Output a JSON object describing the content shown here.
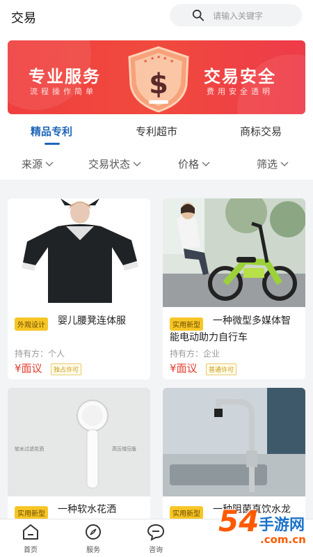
{
  "header": {
    "title": "交易",
    "search_placeholder": "请输入关键字"
  },
  "banner": {
    "left_title": "专业服务",
    "left_subtitle": "流程操作简单",
    "right_title": "交易安全",
    "right_subtitle": "费用安全透明",
    "shield_symbol": "$"
  },
  "tabs": [
    {
      "label": "精品专利",
      "active": true
    },
    {
      "label": "专利超市",
      "active": false
    },
    {
      "label": "商标交易",
      "active": false
    }
  ],
  "filters": [
    {
      "label": "来源"
    },
    {
      "label": "交易状态"
    },
    {
      "label": "价格"
    },
    {
      "label": "筛选"
    }
  ],
  "products": [
    {
      "badge": "外观设计",
      "name": "婴儿腰凳连体服",
      "name_cont": "",
      "holder": "持有方：个人",
      "price": "¥面议",
      "license": "独占许可"
    },
    {
      "badge": "实用新型",
      "name": "一种微型多媒体智",
      "name_cont": "能电动助力自行车",
      "holder": "持有方：企业",
      "price": "¥面议",
      "license": "普通许可"
    },
    {
      "badge": "实用新型",
      "name": "一种软水花洒",
      "name_cont": "",
      "holder": "",
      "price": "",
      "license": ""
    },
    {
      "badge": "实用新型",
      "name": "一种阻菌直饮水龙",
      "name_cont": "",
      "holder": "",
      "price": "",
      "license": ""
    }
  ],
  "showerhead_text": {
    "left": "软水过滤花洒",
    "right": "高压增压版"
  },
  "bottom_nav": [
    {
      "label": "首页",
      "icon": "home-icon"
    },
    {
      "label": "服务",
      "icon": "compass-icon"
    },
    {
      "label": "咨询",
      "icon": "chat-icon"
    }
  ],
  "watermark": {
    "number": "54",
    "text": "手游网",
    "domain": ".com.cn"
  },
  "colors": {
    "accent": "#1f66b8",
    "price": "#e33b2e",
    "badge": "#f7c626",
    "banner": "#ef3f3f"
  }
}
